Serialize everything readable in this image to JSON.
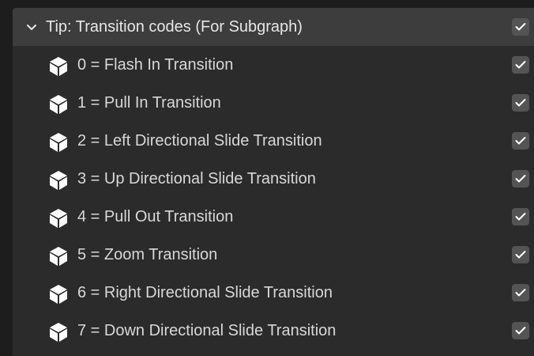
{
  "header": {
    "label": "Tip: Transition codes (For Subgraph)",
    "icon": "chevron-down-icon",
    "checked": true
  },
  "items": [
    {
      "label": "0 = Flash In Transition",
      "icon": "object-cube-icon",
      "checked": true
    },
    {
      "label": "1 = Pull In Transition",
      "icon": "object-cube-icon",
      "checked": true
    },
    {
      "label": "2 = Left Directional Slide Transition",
      "icon": "object-cube-icon",
      "checked": true
    },
    {
      "label": "3 = Up Directional Slide Transition",
      "icon": "object-cube-icon",
      "checked": true
    },
    {
      "label": "4 = Pull Out Transition",
      "icon": "object-cube-icon",
      "checked": true
    },
    {
      "label": "5 = Zoom Transition",
      "icon": "object-cube-icon",
      "checked": true
    },
    {
      "label": "6 = Right Directional Slide Transition",
      "icon": "object-cube-icon",
      "checked": true
    },
    {
      "label": "7 = Down Directional Slide Transition",
      "icon": "object-cube-icon",
      "checked": true
    }
  ],
  "colors": {
    "background": "#1d1d1d",
    "panel": "#2b2b2b",
    "header": "#3d3d3d",
    "checkbox": "#545454",
    "text": "#e6e6e6"
  }
}
